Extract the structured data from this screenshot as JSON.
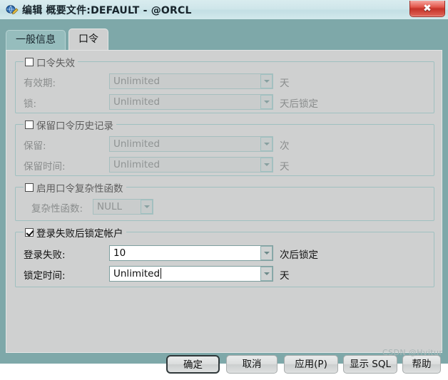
{
  "window": {
    "title": "编辑 概要文件:DEFAULT - @ORCL",
    "close_label": "✖",
    "icon_name": "edit-profile-icon"
  },
  "tabs": [
    {
      "label": "一般信息",
      "active": false
    },
    {
      "label": "口令",
      "active": true
    }
  ],
  "groups": [
    {
      "id": "password-expiry",
      "checkbox_label": "口令失效",
      "checked": false,
      "enabled": false,
      "rows": [
        {
          "label": "有效期:",
          "value": "Unlimited",
          "unit": "天"
        },
        {
          "label": "锁:",
          "value": "Unlimited",
          "unit": "天后锁定"
        }
      ]
    },
    {
      "id": "password-history",
      "checkbox_label": "保留口令历史记录",
      "checked": false,
      "enabled": false,
      "rows": [
        {
          "label": "保留:",
          "value": "Unlimited",
          "unit": "次"
        },
        {
          "label": "保留时间:",
          "value": "Unlimited",
          "unit": "天"
        }
      ]
    },
    {
      "id": "password-complexity",
      "checkbox_label": "启用口令复杂性函数",
      "checked": false,
      "enabled": false,
      "rows": [
        {
          "label": "复杂性函数:",
          "value": "NULL",
          "unit": ""
        }
      ]
    },
    {
      "id": "failed-login-lock",
      "checkbox_label": "登录失败后锁定帐户",
      "checked": true,
      "enabled": true,
      "rows": [
        {
          "label": "登录失败:",
          "value": "10",
          "unit": "次后锁定"
        },
        {
          "label": "锁定时间:",
          "value": "Unlimited",
          "unit": "天"
        }
      ]
    }
  ],
  "buttons": [
    {
      "label": "确定",
      "default": true
    },
    {
      "label": "取消",
      "default": false
    },
    {
      "label": "应用(P)",
      "default": false
    },
    {
      "label": "显示 SQL",
      "default": false
    },
    {
      "label": "帮助",
      "default": false
    }
  ],
  "watermark": "CSDN @Hvitur",
  "colors": {
    "frame": "#7ea8a9",
    "panel": "#cfd0d0",
    "group_border": "#9fc0c0",
    "close_button": "#c53329",
    "titlebar": "#cfe6ea"
  }
}
